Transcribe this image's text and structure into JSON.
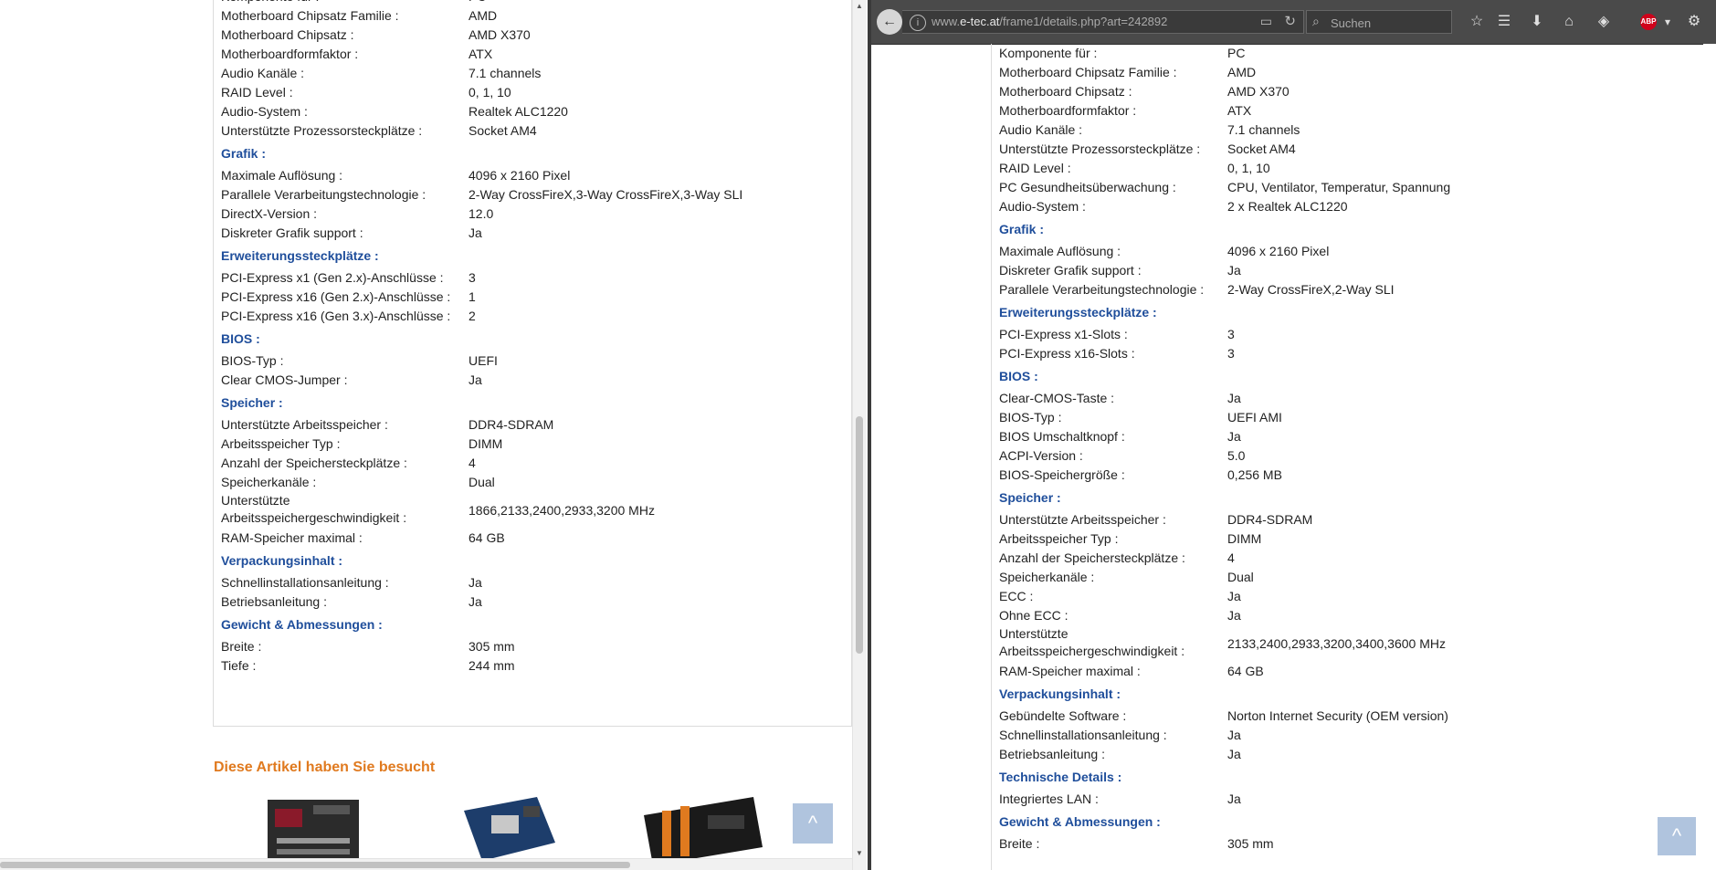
{
  "left": {
    "sections": [
      {
        "heading": "",
        "rows": [
          [
            "Komponente für :",
            "PC"
          ],
          [
            "Motherboard Chipsatz Familie :",
            "AMD"
          ],
          [
            "Motherboard Chipsatz :",
            "AMD X370"
          ],
          [
            "Motherboardformfaktor :",
            "ATX"
          ],
          [
            "Audio Kanäle :",
            "7.1 channels"
          ],
          [
            "RAID Level :",
            "0, 1, 10"
          ],
          [
            "Audio-System :",
            "Realtek ALC1220"
          ],
          [
            "Unterstützte Prozessorsteckplätze :",
            "Socket AM4"
          ]
        ]
      },
      {
        "heading": "Grafik :",
        "rows": [
          [
            "Maximale Auflösung :",
            "4096 x 2160 Pixel"
          ],
          [
            "Parallele Verarbeitungstechnologie :",
            "2-Way CrossFireX,3-Way CrossFireX,3-Way SLI"
          ],
          [
            "DirectX-Version :",
            "12.0"
          ],
          [
            "Diskreter Grafik support :",
            "Ja"
          ]
        ]
      },
      {
        "heading": "Erweiterungssteckplätze :",
        "rows": [
          [
            "PCI-Express x1 (Gen 2.x)-Anschlüsse :",
            "3"
          ],
          [
            "PCI-Express x16 (Gen 2.x)-Anschlüsse :",
            "1"
          ],
          [
            "PCI-Express x16 (Gen 3.x)-Anschlüsse :",
            "2"
          ]
        ]
      },
      {
        "heading": "BIOS :",
        "rows": [
          [
            "BIOS-Typ :",
            "UEFI"
          ],
          [
            "Clear CMOS-Jumper :",
            "Ja"
          ]
        ]
      },
      {
        "heading": "Speicher :",
        "rows": [
          [
            "Unterstützte Arbeitsspeicher :",
            "DDR4-SDRAM"
          ],
          [
            "Arbeitsspeicher Typ :",
            "DIMM"
          ],
          [
            "Anzahl der Speichersteckplätze :",
            "4"
          ],
          [
            "Speicherkanäle :",
            "Dual"
          ],
          [
            "Unterstützte Arbeitsspeichergeschwindigkeit :",
            "1866,2133,2400,2933,3200 MHz"
          ],
          [
            "RAM-Speicher maximal :",
            "64 GB"
          ]
        ]
      },
      {
        "heading": "Verpackungsinhalt :",
        "rows": [
          [
            "Schnellinstallationsanleitung :",
            "Ja"
          ],
          [
            "Betriebsanleitung :",
            "Ja"
          ]
        ]
      },
      {
        "heading": "Gewicht & Abmessungen :",
        "rows": [
          [
            "Breite :",
            "305 mm"
          ],
          [
            "Tiefe :",
            "244 mm"
          ]
        ]
      }
    ],
    "visited_title": "Diese Artikel haben Sie besucht",
    "to_top_glyph": "^"
  },
  "right": {
    "toolbar": {
      "url_prefix": "www.",
      "url_domain": "e-tec.at",
      "url_path": "/frame1/details.php?art=242892",
      "search_placeholder": "Suchen",
      "abp_label": "ABP"
    },
    "sections": [
      {
        "heading": "",
        "rows": [
          [
            "Komponente für :",
            "PC"
          ],
          [
            "Motherboard Chipsatz Familie :",
            "AMD"
          ],
          [
            "Motherboard Chipsatz :",
            "AMD X370"
          ],
          [
            "Motherboardformfaktor :",
            "ATX"
          ],
          [
            "Audio Kanäle :",
            "7.1 channels"
          ],
          [
            "Unterstützte Prozessorsteckplätze :",
            "Socket AM4"
          ],
          [
            "RAID Level :",
            "0, 1, 10"
          ],
          [
            "PC Gesundheitsüberwachung :",
            "CPU, Ventilator, Temperatur, Spannung"
          ],
          [
            "Audio-System :",
            "2 x Realtek ALC1220"
          ]
        ]
      },
      {
        "heading": "Grafik :",
        "rows": [
          [
            "Maximale Auflösung :",
            "4096 x 2160 Pixel"
          ],
          [
            "Diskreter Grafik support :",
            "Ja"
          ],
          [
            "Parallele Verarbeitungstechnologie :",
            "2-Way CrossFireX,2-Way SLI"
          ]
        ]
      },
      {
        "heading": "Erweiterungssteckplätze :",
        "rows": [
          [
            "PCI-Express x1-Slots :",
            "3"
          ],
          [
            "PCI-Express x16-Slots :",
            "3"
          ]
        ]
      },
      {
        "heading": "BIOS :",
        "rows": [
          [
            "Clear-CMOS-Taste :",
            "Ja"
          ],
          [
            "BIOS-Typ :",
            "UEFI AMI"
          ],
          [
            "BIOS Umschaltknopf :",
            "Ja"
          ],
          [
            "ACPI-Version :",
            "5.0"
          ],
          [
            "BIOS-Speichergröße :",
            "0,256 MB"
          ]
        ]
      },
      {
        "heading": "Speicher :",
        "rows": [
          [
            "Unterstützte Arbeitsspeicher :",
            "DDR4-SDRAM"
          ],
          [
            "Arbeitsspeicher Typ :",
            "DIMM"
          ],
          [
            "Anzahl der Speichersteckplätze :",
            "4"
          ],
          [
            "Speicherkanäle :",
            "Dual"
          ],
          [
            "ECC :",
            "Ja"
          ],
          [
            "Ohne ECC :",
            "Ja"
          ],
          [
            "Unterstützte Arbeitsspeichergeschwindigkeit :",
            "2133,2400,2933,3200,3400,3600 MHz"
          ],
          [
            "RAM-Speicher maximal :",
            "64 GB"
          ]
        ]
      },
      {
        "heading": "Verpackungsinhalt :",
        "rows": [
          [
            "Gebündelte Software :",
            "Norton Internet Security (OEM version)"
          ],
          [
            "Schnellinstallationsanleitung :",
            "Ja"
          ],
          [
            "Betriebsanleitung :",
            "Ja"
          ]
        ]
      },
      {
        "heading": "Technische Details :",
        "rows": [
          [
            "Integriertes LAN :",
            "Ja"
          ]
        ]
      },
      {
        "heading": "Gewicht & Abmessungen :",
        "rows": [
          [
            "Breite :",
            "305 mm"
          ]
        ]
      }
    ],
    "to_top_glyph": "^"
  },
  "colors": {
    "heading": "#1f4e9b",
    "visited_title": "#e07a1f",
    "to_top": "#b0c4de",
    "toolbar": "#4a4a4a"
  }
}
